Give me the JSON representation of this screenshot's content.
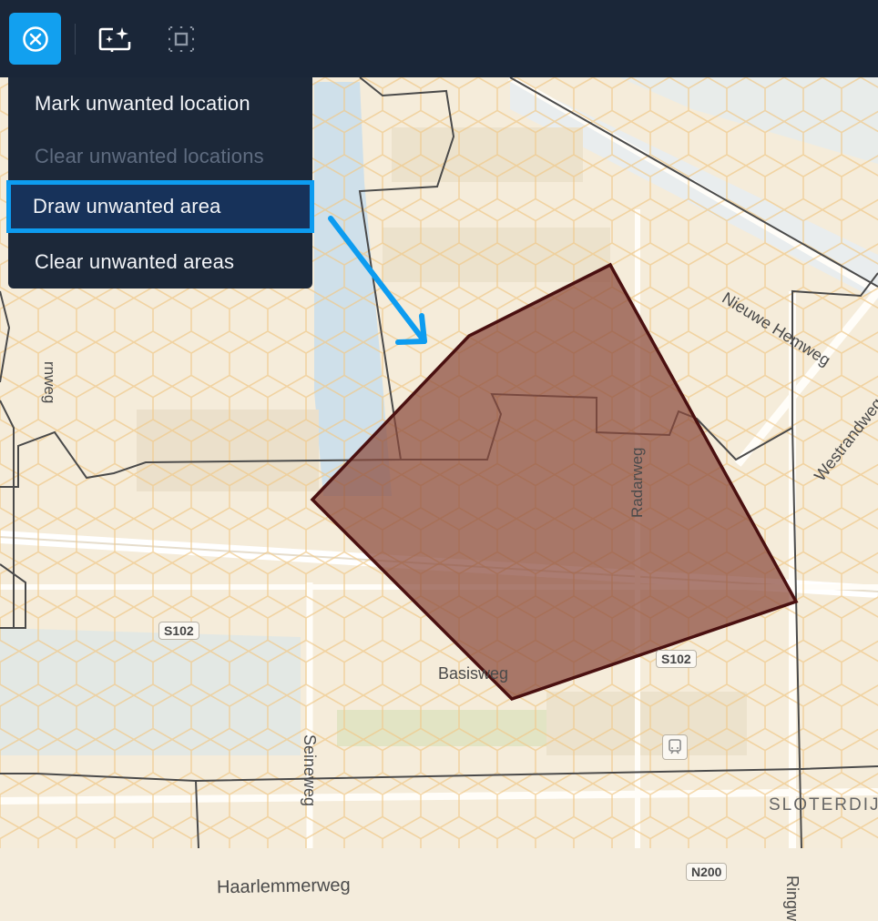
{
  "toolbar": {
    "tools": [
      {
        "icon": "close-circle-icon",
        "active": true
      },
      {
        "icon": "magic-select-icon",
        "active": false
      },
      {
        "icon": "area-select-icon",
        "active": false
      }
    ]
  },
  "menu": {
    "items": [
      {
        "label": "Mark unwanted location",
        "state": "enabled"
      },
      {
        "label": "Clear unwanted locations",
        "state": "disabled"
      },
      {
        "label": "Draw unwanted area",
        "state": "selected"
      },
      {
        "label": "Clear unwanted areas",
        "state": "enabled"
      }
    ]
  },
  "map": {
    "street_labels": {
      "nieuwe_hemweg": "Nieuwe Hemweg",
      "westrandweg": "Westrandweg",
      "radarweg": "Radarweg",
      "basisweg": "Basisweg",
      "seineweg": "Seineweg",
      "haarlemmerweg": "Haarlemmerweg",
      "sloterdijk": "SLOTERDIJ",
      "ringweg": "Ringw",
      "left_edge_weg": "rnweg"
    },
    "road_shields": [
      "S102",
      "S102",
      "N200"
    ]
  },
  "colors": {
    "toolbar_bg": "#1a2638",
    "accent": "#12a0ef",
    "menu_bg": "#1c2839",
    "polygon_fill": "#8b4a3c",
    "polygon_stroke": "#4a1010",
    "arrow": "#0d9cf0"
  }
}
